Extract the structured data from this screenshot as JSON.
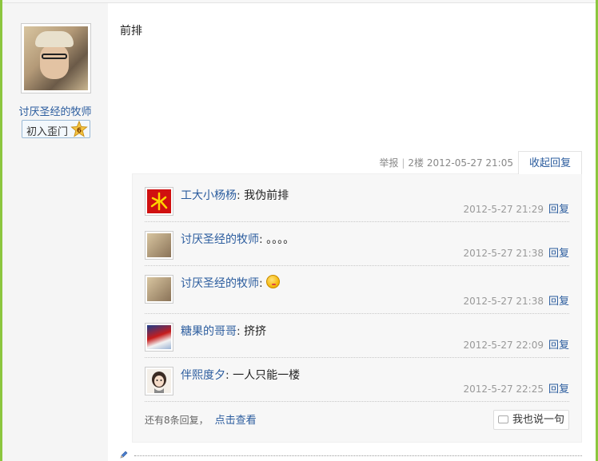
{
  "author": {
    "name": "讨厌圣经的牧师",
    "rank_label": "初入歪门",
    "level": "6"
  },
  "post": {
    "content": "前排",
    "report": "举报",
    "separator": "|",
    "floor": "2楼",
    "datetime": "2012-05-27 21:05",
    "collapse_label": "收起回复"
  },
  "replies": [
    {
      "name": "工大小杨杨",
      "colon": ":",
      "content": "我伪前排",
      "time": "2012-5-27 21:29",
      "reply_label": "回复"
    },
    {
      "name": "讨厌圣经的牧师",
      "colon": ":",
      "content": "。。。。",
      "time": "2012-5-27 21:38",
      "reply_label": "回复"
    },
    {
      "name": "讨厌圣经的牧师",
      "colon": ":",
      "content": "",
      "time": "2012-5-27 21:38",
      "reply_label": "回复",
      "emoji": "smiley-face"
    },
    {
      "name": "糖果的哥哥",
      "colon": ":",
      "content": "挤挤",
      "time": "2012-5-27 22:09",
      "reply_label": "回复"
    },
    {
      "name": "伴熙度夕",
      "colon": ":",
      "content": "一人只能一楼",
      "time": "2012-5-27 22:25",
      "reply_label": "回复"
    }
  ],
  "more": {
    "text": "还有8条回复，",
    "link": "点击查看"
  },
  "say_button": "我也说一句",
  "colors": {
    "link": "#2b5c9e",
    "frame": "#8cc63f",
    "panel": "#f7f7f7"
  }
}
